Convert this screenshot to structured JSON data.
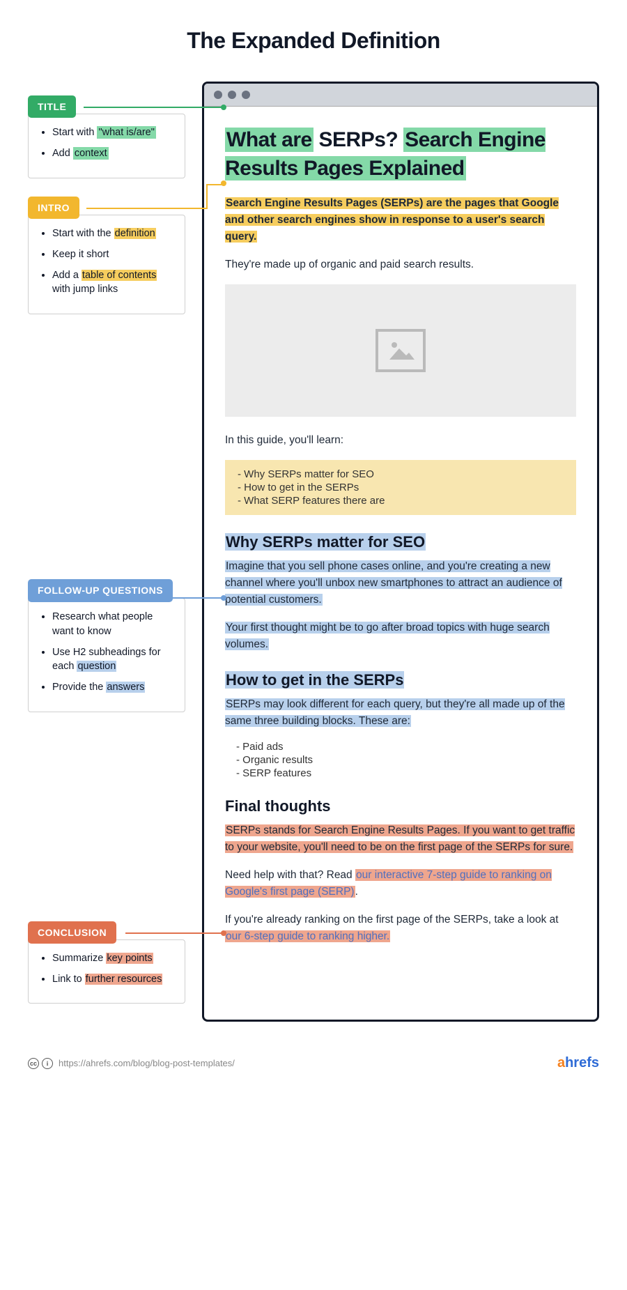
{
  "page_title": "The Expanded Definition",
  "sidebar": {
    "title": {
      "label": "TITLE",
      "bullets_html": [
        "Start with <span class='hl-green'>\"what is/are\"</span>",
        "Add <span class='hl-green'>context</span>"
      ]
    },
    "intro": {
      "label": "INTRO",
      "bullets_html": [
        "Start with the <span class='hl-yellow'>definition</span>",
        "Keep it short",
        "Add a <span class='hl-yellow'>table of contents</span> with jump links"
      ]
    },
    "followup": {
      "label": "FOLLOW-UP QUESTIONS",
      "bullets_html": [
        "Research what people want to know",
        "Use H2 subheadings for each <span class='hl-blue'>question</span>",
        "Provide the <span class='hl-blue'>answers</span>"
      ]
    },
    "conclusion": {
      "label": "CONCLUSION",
      "bullets_html": [
        "Summarize <span class='hl-red'>key points</span>",
        "Link to <span class='hl-red'>further resources</span>"
      ]
    }
  },
  "article": {
    "h1_html": "<span class='hl-green'>What are</span> SERPs? <span class='hl-green'>Search Engine Results Pages Explained</span>",
    "intro_def_html": "<span class='hl-yellow'>Search Engine Results Pages (SERPs) are the pages that Google and other search engines show in response to a user's search query.</span>",
    "intro_line2": "They're made up of organic and paid search results.",
    "guide_lead": "In this guide, you'll learn:",
    "toc": [
      "- Why SERPs matter for SEO",
      "- How to get in the SERPs",
      "- What SERP features there are"
    ],
    "h2_a_html": "<span class='hl-blue'>Why SERPs matter for SEO</span>",
    "p_a1_html": "<span class='hl-blue'>Imagine that you sell phone cases online, and you're creating a new channel where you'll unbox new smartphones to attract an audience of potential customers.</span>",
    "p_a2_html": "<span class='hl-blue'>Your first thought might be to go after broad topics with huge search volumes.</span>",
    "h2_b_html": "<span class='hl-blue'>How to get in the SERPs</span>",
    "p_b1_html": "<span class='hl-blue'>SERPs may look different for each query, but they're all made up of the same three building blocks. These are:</span>",
    "blocks_list": [
      "- Paid ads",
      "- Organic results",
      "- SERP features"
    ],
    "h2_final": "Final thoughts",
    "p_f1_html": "<span class='hl-red'>SERPs stands for Search Engine Results Pages. If you want to get traffic to your website, you'll need to be on the first page of the SERPs for sure.</span>",
    "p_f2_html": "Need help with that? Read <a class='linklike' data-name='cta-link-1' data-interactable='true'><span class='hl-red'>our interactive 7-step guide to ranking on Google's first page (SERP)</span></a>.",
    "p_f3_html": "If you're already ranking on the first page of the SERPs, take a look at <a class='linklike' data-name='cta-link-2' data-interactable='true'><span class='hl-red'>our 6-step guide to ranking higher.</span></a>"
  },
  "footer": {
    "url": "https://ahrefs.com/blog/blog-post-templates/",
    "brand": "ahrefs"
  }
}
